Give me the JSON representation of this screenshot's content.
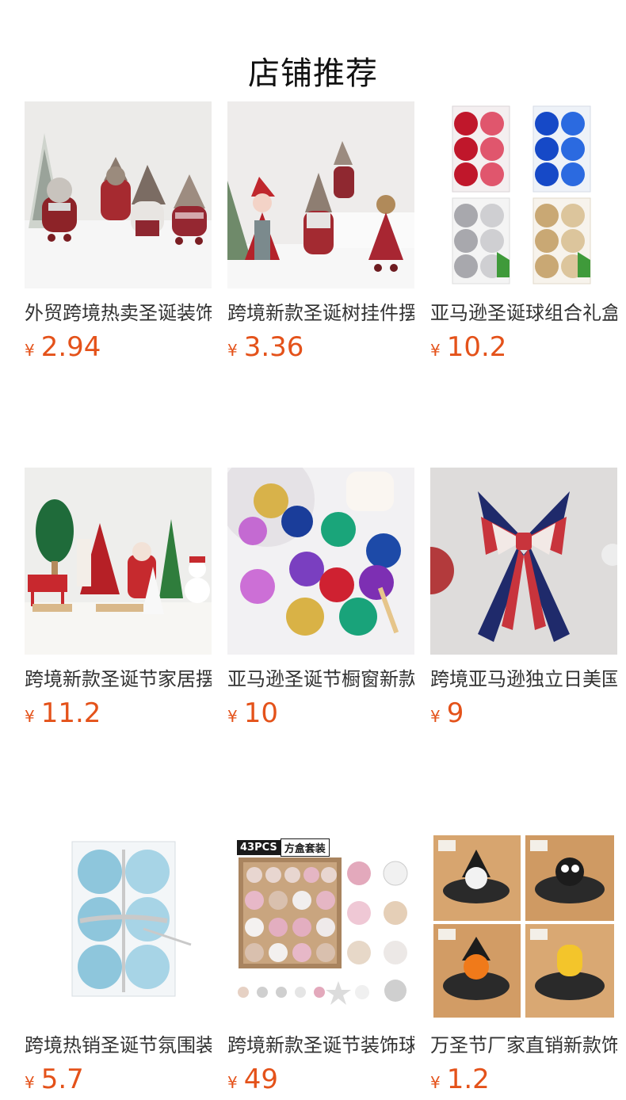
{
  "page": {
    "title": "店铺推荐"
  },
  "currency_symbol": "¥",
  "products": [
    {
      "name": "外贸跨境热卖圣诞装饰",
      "price": "2.94",
      "image_icon": "christmas-gnome-dolls-image"
    },
    {
      "name": "跨境新款圣诞树挂件摆",
      "price": "3.36",
      "image_icon": "christmas-plush-ornaments-image"
    },
    {
      "name": "亚马逊圣诞球组合礼盒",
      "price": "10.2",
      "image_icon": "christmas-ball-boxes-image"
    },
    {
      "name": "跨境新款圣诞节家居摆",
      "price": "11.2",
      "image_icon": "christmas-tree-figurines-image"
    },
    {
      "name": "亚马逊圣诞节橱窗新款",
      "price": "10",
      "image_icon": "colorful-christmas-balls-image"
    },
    {
      "name": "跨境亚马逊独立日美国",
      "price": "9",
      "image_icon": "patriotic-bow-image"
    },
    {
      "name": "跨境热销圣诞节氛围装",
      "price": "5.7",
      "image_icon": "blue-ball-box-image"
    },
    {
      "name": "跨境新款圣诞节装饰球",
      "price": "49",
      "image_icon": "ornament-set-image",
      "badge_count": "43PCS",
      "badge_label": "方盒套装"
    },
    {
      "name": "万圣节厂家直销新款饰",
      "price": "1.2",
      "image_icon": "halloween-hair-clips-image"
    }
  ],
  "colors": {
    "price": "#e4521a",
    "text": "#333333",
    "title": "#111111"
  }
}
